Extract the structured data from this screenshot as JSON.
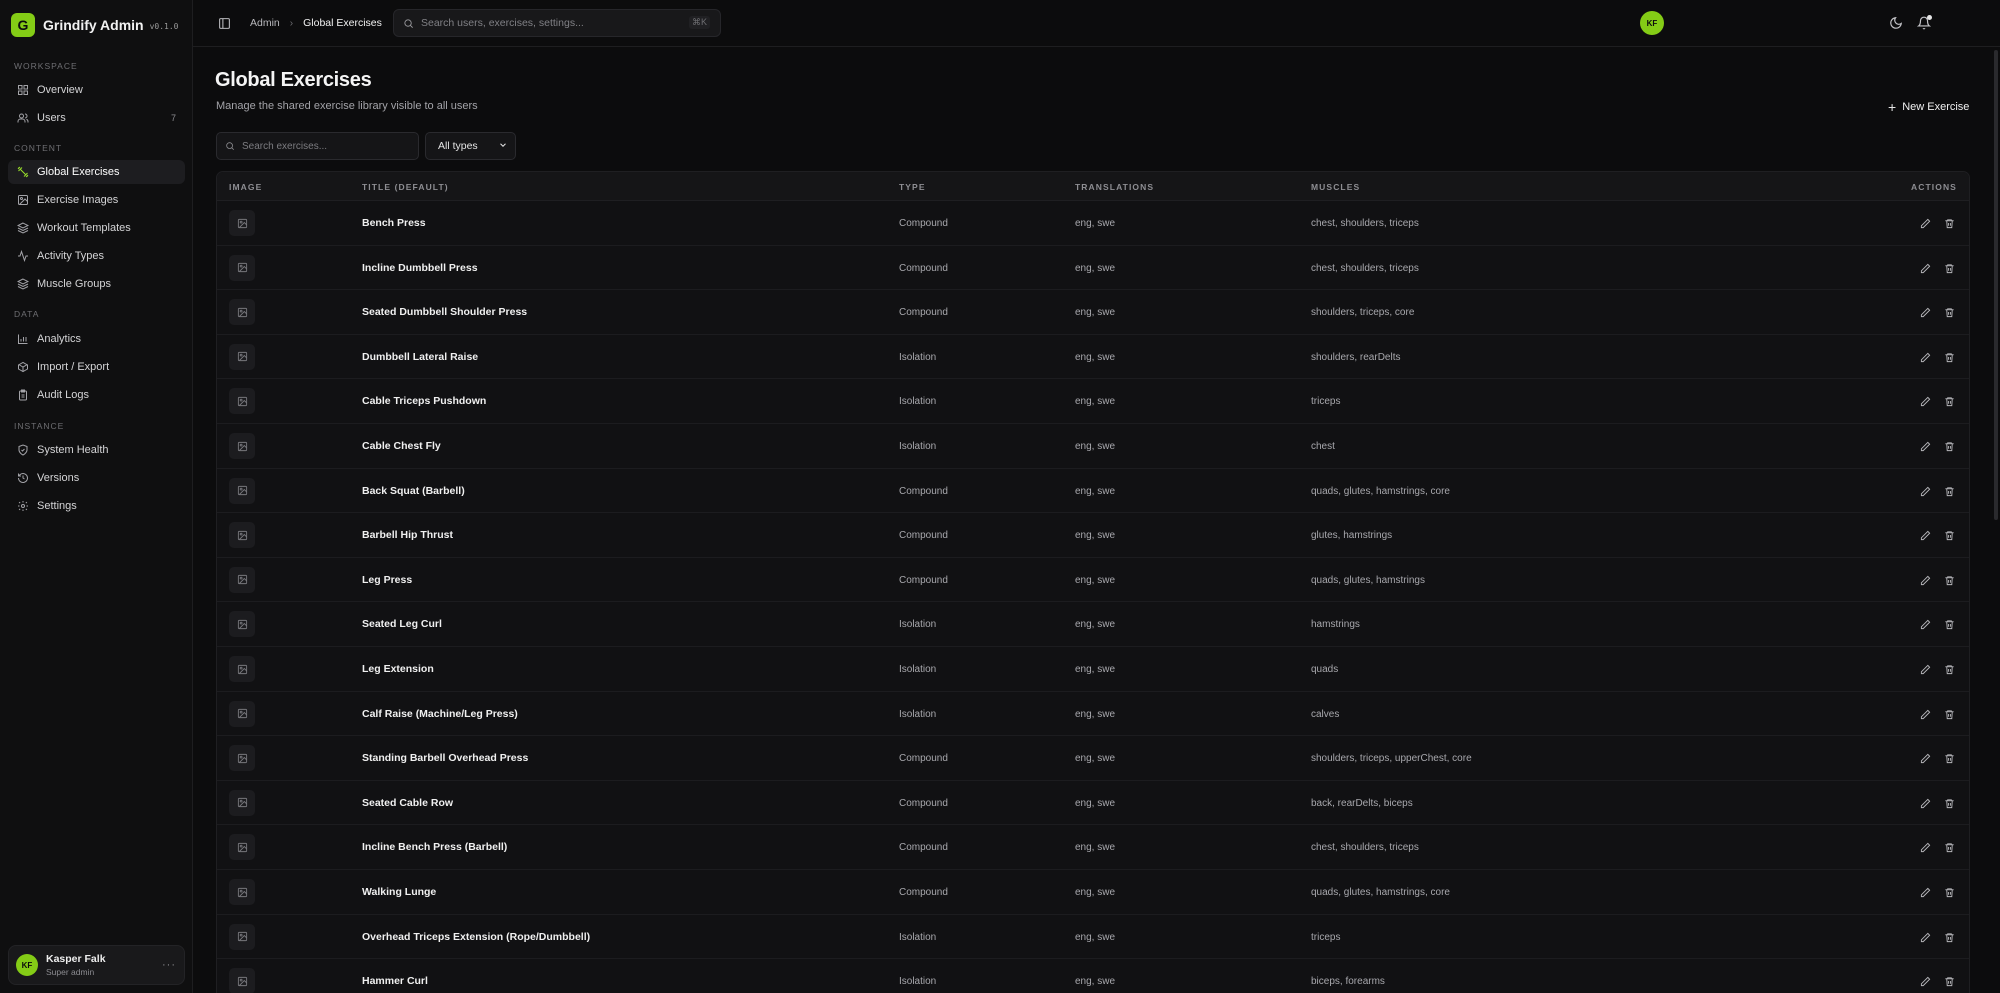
{
  "app": {
    "logo_letter": "G",
    "name": "Grindify Admin",
    "version": "v0.1.0"
  },
  "sidebar": {
    "sections": [
      {
        "label": "WORKSPACE"
      },
      {
        "label": "CONTENT"
      },
      {
        "label": "DATA"
      },
      {
        "label": "INSTANCE"
      }
    ],
    "items": [
      {
        "label": "Overview",
        "icon": "grid-icon"
      },
      {
        "label": "Users",
        "icon": "users-icon",
        "count": "7"
      },
      {
        "label": "Global Exercises",
        "icon": "dumbbell-icon",
        "active": true
      },
      {
        "label": "Exercise Images",
        "icon": "image-icon"
      },
      {
        "label": "Workout Templates",
        "icon": "layers-icon"
      },
      {
        "label": "Activity Types",
        "icon": "activity-icon"
      },
      {
        "label": "Muscle Groups",
        "icon": "layers-icon"
      },
      {
        "label": "Analytics",
        "icon": "bar-chart-icon"
      },
      {
        "label": "Import / Export",
        "icon": "package-icon"
      },
      {
        "label": "Audit Logs",
        "icon": "clipboard-icon"
      },
      {
        "label": "System Health",
        "icon": "shield-icon"
      },
      {
        "label": "Versions",
        "icon": "history-icon"
      },
      {
        "label": "Settings",
        "icon": "gear-icon"
      }
    ],
    "user": {
      "initials": "KF",
      "name": "Kasper Falk",
      "role": "Super admin",
      "more": "···"
    }
  },
  "topbar": {
    "breadcrumb": [
      "Admin",
      "Global Exercises"
    ],
    "breadcrumb_sep": "›",
    "search_placeholder": "Search users, exercises, settings...",
    "search_shortcut": "⌘K",
    "avatar_initials": "KF"
  },
  "main": {
    "title": "Global Exercises",
    "subtitle": "Manage the shared exercise library visible to all users",
    "new_button": "New Exercise",
    "filter_placeholder": "Search exercises...",
    "type_filter": "All types",
    "columns": [
      "IMAGE",
      "TITLE (DEFAULT)",
      "TYPE",
      "TRANSLATIONS",
      "MUSCLES",
      "ACTIONS"
    ],
    "rows": [
      {
        "title": "Bench Press",
        "type": "Compound",
        "translations": "eng, swe",
        "muscles": "chest, shoulders, triceps"
      },
      {
        "title": "Incline Dumbbell Press",
        "type": "Compound",
        "translations": "eng, swe",
        "muscles": "chest, shoulders, triceps"
      },
      {
        "title": "Seated Dumbbell Shoulder Press",
        "type": "Compound",
        "translations": "eng, swe",
        "muscles": "shoulders, triceps, core"
      },
      {
        "title": "Dumbbell Lateral Raise",
        "type": "Isolation",
        "translations": "eng, swe",
        "muscles": "shoulders, rearDelts"
      },
      {
        "title": "Cable Triceps Pushdown",
        "type": "Isolation",
        "translations": "eng, swe",
        "muscles": "triceps"
      },
      {
        "title": "Cable Chest Fly",
        "type": "Isolation",
        "translations": "eng, swe",
        "muscles": "chest"
      },
      {
        "title": "Back Squat (Barbell)",
        "type": "Compound",
        "translations": "eng, swe",
        "muscles": "quads, glutes, hamstrings, core"
      },
      {
        "title": "Barbell Hip Thrust",
        "type": "Compound",
        "translations": "eng, swe",
        "muscles": "glutes, hamstrings"
      },
      {
        "title": "Leg Press",
        "type": "Compound",
        "translations": "eng, swe",
        "muscles": "quads, glutes, hamstrings"
      },
      {
        "title": "Seated Leg Curl",
        "type": "Isolation",
        "translations": "eng, swe",
        "muscles": "hamstrings"
      },
      {
        "title": "Leg Extension",
        "type": "Isolation",
        "translations": "eng, swe",
        "muscles": "quads"
      },
      {
        "title": "Calf Raise (Machine/Leg Press)",
        "type": "Isolation",
        "translations": "eng, swe",
        "muscles": "calves"
      },
      {
        "title": "Standing Barbell Overhead Press",
        "type": "Compound",
        "translations": "eng, swe",
        "muscles": "shoulders, triceps, upperChest, core"
      },
      {
        "title": "Seated Cable Row",
        "type": "Compound",
        "translations": "eng, swe",
        "muscles": "back, rearDelts, biceps"
      },
      {
        "title": "Incline Bench Press (Barbell)",
        "type": "Compound",
        "translations": "eng, swe",
        "muscles": "chest, shoulders, triceps"
      },
      {
        "title": "Walking Lunge",
        "type": "Compound",
        "translations": "eng, swe",
        "muscles": "quads, glutes, hamstrings, core"
      },
      {
        "title": "Overhead Triceps Extension (Rope/Dumbbell)",
        "type": "Isolation",
        "translations": "eng, swe",
        "muscles": "triceps"
      },
      {
        "title": "Hammer Curl",
        "type": "Isolation",
        "translations": "eng, swe",
        "muscles": "biceps, forearms"
      }
    ]
  },
  "colors": {
    "accent": "#84cc16",
    "background": "#0c0c0d",
    "surface": "#111113"
  }
}
